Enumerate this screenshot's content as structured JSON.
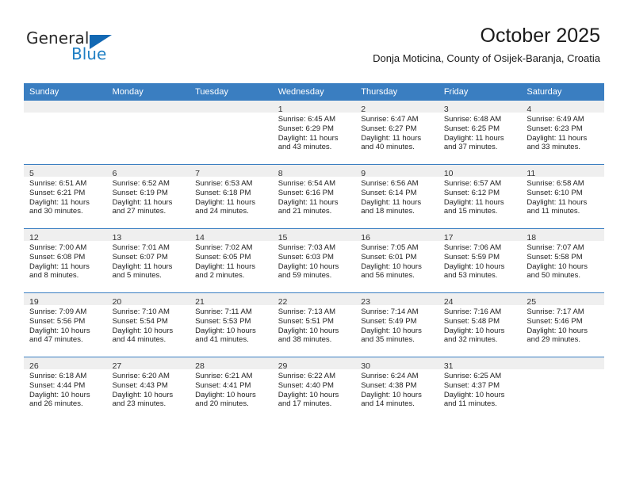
{
  "brand": {
    "name_part1": "General",
    "name_part2": "Blue",
    "logo_icon": "blue-triangle-icon"
  },
  "header": {
    "month_title": "October 2025",
    "location": "Donja Moticina, County of Osijek-Baranja, Croatia"
  },
  "colors": {
    "header_blue": "#3a7ec1",
    "daynum_band": "#efefef",
    "brand_blue": "#1f7fc4",
    "logo_blue": "#1268b3"
  },
  "calendar": {
    "weekday_headers": [
      "Sunday",
      "Monday",
      "Tuesday",
      "Wednesday",
      "Thursday",
      "Friday",
      "Saturday"
    ],
    "weeks": [
      [
        {
          "day": "",
          "lines": []
        },
        {
          "day": "",
          "lines": []
        },
        {
          "day": "",
          "lines": []
        },
        {
          "day": "1",
          "lines": [
            "Sunrise: 6:45 AM",
            "Sunset: 6:29 PM",
            "Daylight: 11 hours",
            "and 43 minutes."
          ]
        },
        {
          "day": "2",
          "lines": [
            "Sunrise: 6:47 AM",
            "Sunset: 6:27 PM",
            "Daylight: 11 hours",
            "and 40 minutes."
          ]
        },
        {
          "day": "3",
          "lines": [
            "Sunrise: 6:48 AM",
            "Sunset: 6:25 PM",
            "Daylight: 11 hours",
            "and 37 minutes."
          ]
        },
        {
          "day": "4",
          "lines": [
            "Sunrise: 6:49 AM",
            "Sunset: 6:23 PM",
            "Daylight: 11 hours",
            "and 33 minutes."
          ]
        }
      ],
      [
        {
          "day": "5",
          "lines": [
            "Sunrise: 6:51 AM",
            "Sunset: 6:21 PM",
            "Daylight: 11 hours",
            "and 30 minutes."
          ]
        },
        {
          "day": "6",
          "lines": [
            "Sunrise: 6:52 AM",
            "Sunset: 6:19 PM",
            "Daylight: 11 hours",
            "and 27 minutes."
          ]
        },
        {
          "day": "7",
          "lines": [
            "Sunrise: 6:53 AM",
            "Sunset: 6:18 PM",
            "Daylight: 11 hours",
            "and 24 minutes."
          ]
        },
        {
          "day": "8",
          "lines": [
            "Sunrise: 6:54 AM",
            "Sunset: 6:16 PM",
            "Daylight: 11 hours",
            "and 21 minutes."
          ]
        },
        {
          "day": "9",
          "lines": [
            "Sunrise: 6:56 AM",
            "Sunset: 6:14 PM",
            "Daylight: 11 hours",
            "and 18 minutes."
          ]
        },
        {
          "day": "10",
          "lines": [
            "Sunrise: 6:57 AM",
            "Sunset: 6:12 PM",
            "Daylight: 11 hours",
            "and 15 minutes."
          ]
        },
        {
          "day": "11",
          "lines": [
            "Sunrise: 6:58 AM",
            "Sunset: 6:10 PM",
            "Daylight: 11 hours",
            "and 11 minutes."
          ]
        }
      ],
      [
        {
          "day": "12",
          "lines": [
            "Sunrise: 7:00 AM",
            "Sunset: 6:08 PM",
            "Daylight: 11 hours",
            "and 8 minutes."
          ]
        },
        {
          "day": "13",
          "lines": [
            "Sunrise: 7:01 AM",
            "Sunset: 6:07 PM",
            "Daylight: 11 hours",
            "and 5 minutes."
          ]
        },
        {
          "day": "14",
          "lines": [
            "Sunrise: 7:02 AM",
            "Sunset: 6:05 PM",
            "Daylight: 11 hours",
            "and 2 minutes."
          ]
        },
        {
          "day": "15",
          "lines": [
            "Sunrise: 7:03 AM",
            "Sunset: 6:03 PM",
            "Daylight: 10 hours",
            "and 59 minutes."
          ]
        },
        {
          "day": "16",
          "lines": [
            "Sunrise: 7:05 AM",
            "Sunset: 6:01 PM",
            "Daylight: 10 hours",
            "and 56 minutes."
          ]
        },
        {
          "day": "17",
          "lines": [
            "Sunrise: 7:06 AM",
            "Sunset: 5:59 PM",
            "Daylight: 10 hours",
            "and 53 minutes."
          ]
        },
        {
          "day": "18",
          "lines": [
            "Sunrise: 7:07 AM",
            "Sunset: 5:58 PM",
            "Daylight: 10 hours",
            "and 50 minutes."
          ]
        }
      ],
      [
        {
          "day": "19",
          "lines": [
            "Sunrise: 7:09 AM",
            "Sunset: 5:56 PM",
            "Daylight: 10 hours",
            "and 47 minutes."
          ]
        },
        {
          "day": "20",
          "lines": [
            "Sunrise: 7:10 AM",
            "Sunset: 5:54 PM",
            "Daylight: 10 hours",
            "and 44 minutes."
          ]
        },
        {
          "day": "21",
          "lines": [
            "Sunrise: 7:11 AM",
            "Sunset: 5:53 PM",
            "Daylight: 10 hours",
            "and 41 minutes."
          ]
        },
        {
          "day": "22",
          "lines": [
            "Sunrise: 7:13 AM",
            "Sunset: 5:51 PM",
            "Daylight: 10 hours",
            "and 38 minutes."
          ]
        },
        {
          "day": "23",
          "lines": [
            "Sunrise: 7:14 AM",
            "Sunset: 5:49 PM",
            "Daylight: 10 hours",
            "and 35 minutes."
          ]
        },
        {
          "day": "24",
          "lines": [
            "Sunrise: 7:16 AM",
            "Sunset: 5:48 PM",
            "Daylight: 10 hours",
            "and 32 minutes."
          ]
        },
        {
          "day": "25",
          "lines": [
            "Sunrise: 7:17 AM",
            "Sunset: 5:46 PM",
            "Daylight: 10 hours",
            "and 29 minutes."
          ]
        }
      ],
      [
        {
          "day": "26",
          "lines": [
            "Sunrise: 6:18 AM",
            "Sunset: 4:44 PM",
            "Daylight: 10 hours",
            "and 26 minutes."
          ]
        },
        {
          "day": "27",
          "lines": [
            "Sunrise: 6:20 AM",
            "Sunset: 4:43 PM",
            "Daylight: 10 hours",
            "and 23 minutes."
          ]
        },
        {
          "day": "28",
          "lines": [
            "Sunrise: 6:21 AM",
            "Sunset: 4:41 PM",
            "Daylight: 10 hours",
            "and 20 minutes."
          ]
        },
        {
          "day": "29",
          "lines": [
            "Sunrise: 6:22 AM",
            "Sunset: 4:40 PM",
            "Daylight: 10 hours",
            "and 17 minutes."
          ]
        },
        {
          "day": "30",
          "lines": [
            "Sunrise: 6:24 AM",
            "Sunset: 4:38 PM",
            "Daylight: 10 hours",
            "and 14 minutes."
          ]
        },
        {
          "day": "31",
          "lines": [
            "Sunrise: 6:25 AM",
            "Sunset: 4:37 PM",
            "Daylight: 10 hours",
            "and 11 minutes."
          ]
        },
        {
          "day": "",
          "lines": []
        }
      ]
    ]
  }
}
